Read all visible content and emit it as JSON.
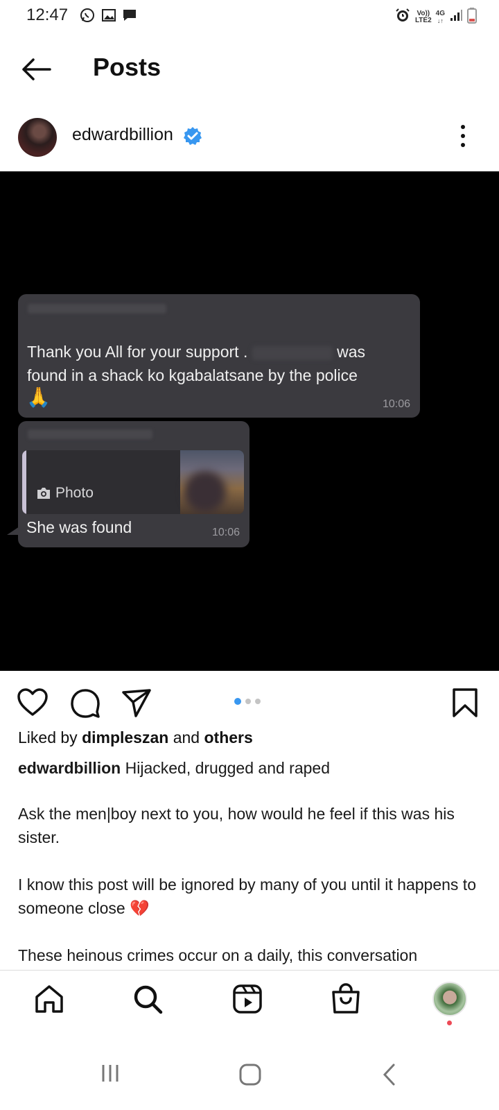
{
  "status_bar": {
    "time": "12:47",
    "left_icons": [
      "whatsapp-icon",
      "gallery-icon",
      "message-icon"
    ],
    "right_icons": [
      "alarm-icon",
      "volte-icon",
      "4g-icon",
      "signal-icon",
      "battery-icon"
    ],
    "volte_label": "Vo))",
    "lte_label": "LTE2",
    "network_label": "4G"
  },
  "header": {
    "title": "Posts"
  },
  "post": {
    "author": "edwardbillion",
    "verified": true,
    "image": {
      "message1": {
        "text_before": "Thank you All for your support .",
        "text_after": "was found in a shack ko kgabalatsane by the police",
        "emoji": "🙏",
        "time": "10:06"
      },
      "message2": {
        "quote_label": "Photo",
        "text": "She was found",
        "time": "10:06"
      }
    },
    "carousel": {
      "total": 3,
      "active": 1
    },
    "likes": {
      "prefix": "Liked by",
      "user": "dimpleszan",
      "connector": "and",
      "others": "others"
    },
    "caption": {
      "user": "edwardbillion",
      "lead": "Hijacked, drugged and raped",
      "p1": "Ask the men|boy next to you, how would he feel if this was his sister.",
      "p2": "I know this post will be ignored by many of you until it happens to someone close 💔",
      "p3": "These heinous crimes occur on a daily, this conversation"
    }
  },
  "bottom_nav": {
    "items": [
      "home-icon",
      "search-icon",
      "reels-icon",
      "shop-icon",
      "profile-avatar"
    ]
  },
  "colors": {
    "accent": "#3897f0",
    "verified": "#3897f0",
    "notification": "#ed4956",
    "bubble": "#3b3a3f"
  }
}
